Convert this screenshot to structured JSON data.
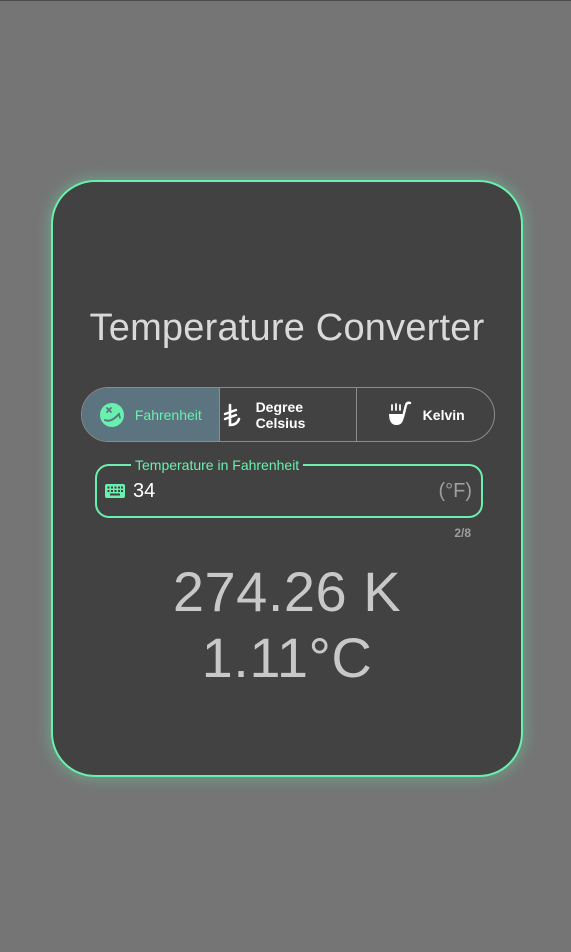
{
  "app": {
    "title": "Temperature Converter"
  },
  "units": {
    "options": [
      {
        "label": "Fahrenheit",
        "icon": "thermometer-face-icon",
        "selected": true
      },
      {
        "label": "Degree Celsius",
        "icon": "celsius-symbol-icon",
        "selected": false
      },
      {
        "label": "Kelvin",
        "icon": "ladle-icon",
        "selected": false
      }
    ]
  },
  "input": {
    "label": "Temperature in Fahrenheit",
    "value": "34",
    "suffix": "(°F)",
    "icon": "keyboard-icon",
    "counter": "2/8"
  },
  "results": {
    "kelvin": "274.26 K",
    "celsius": "1.11°C"
  },
  "colors": {
    "background": "#757575",
    "card": "#424242",
    "accent": "#69f0ae",
    "selected_segment": "#5c7480",
    "text_light": "#d9d9d9"
  }
}
